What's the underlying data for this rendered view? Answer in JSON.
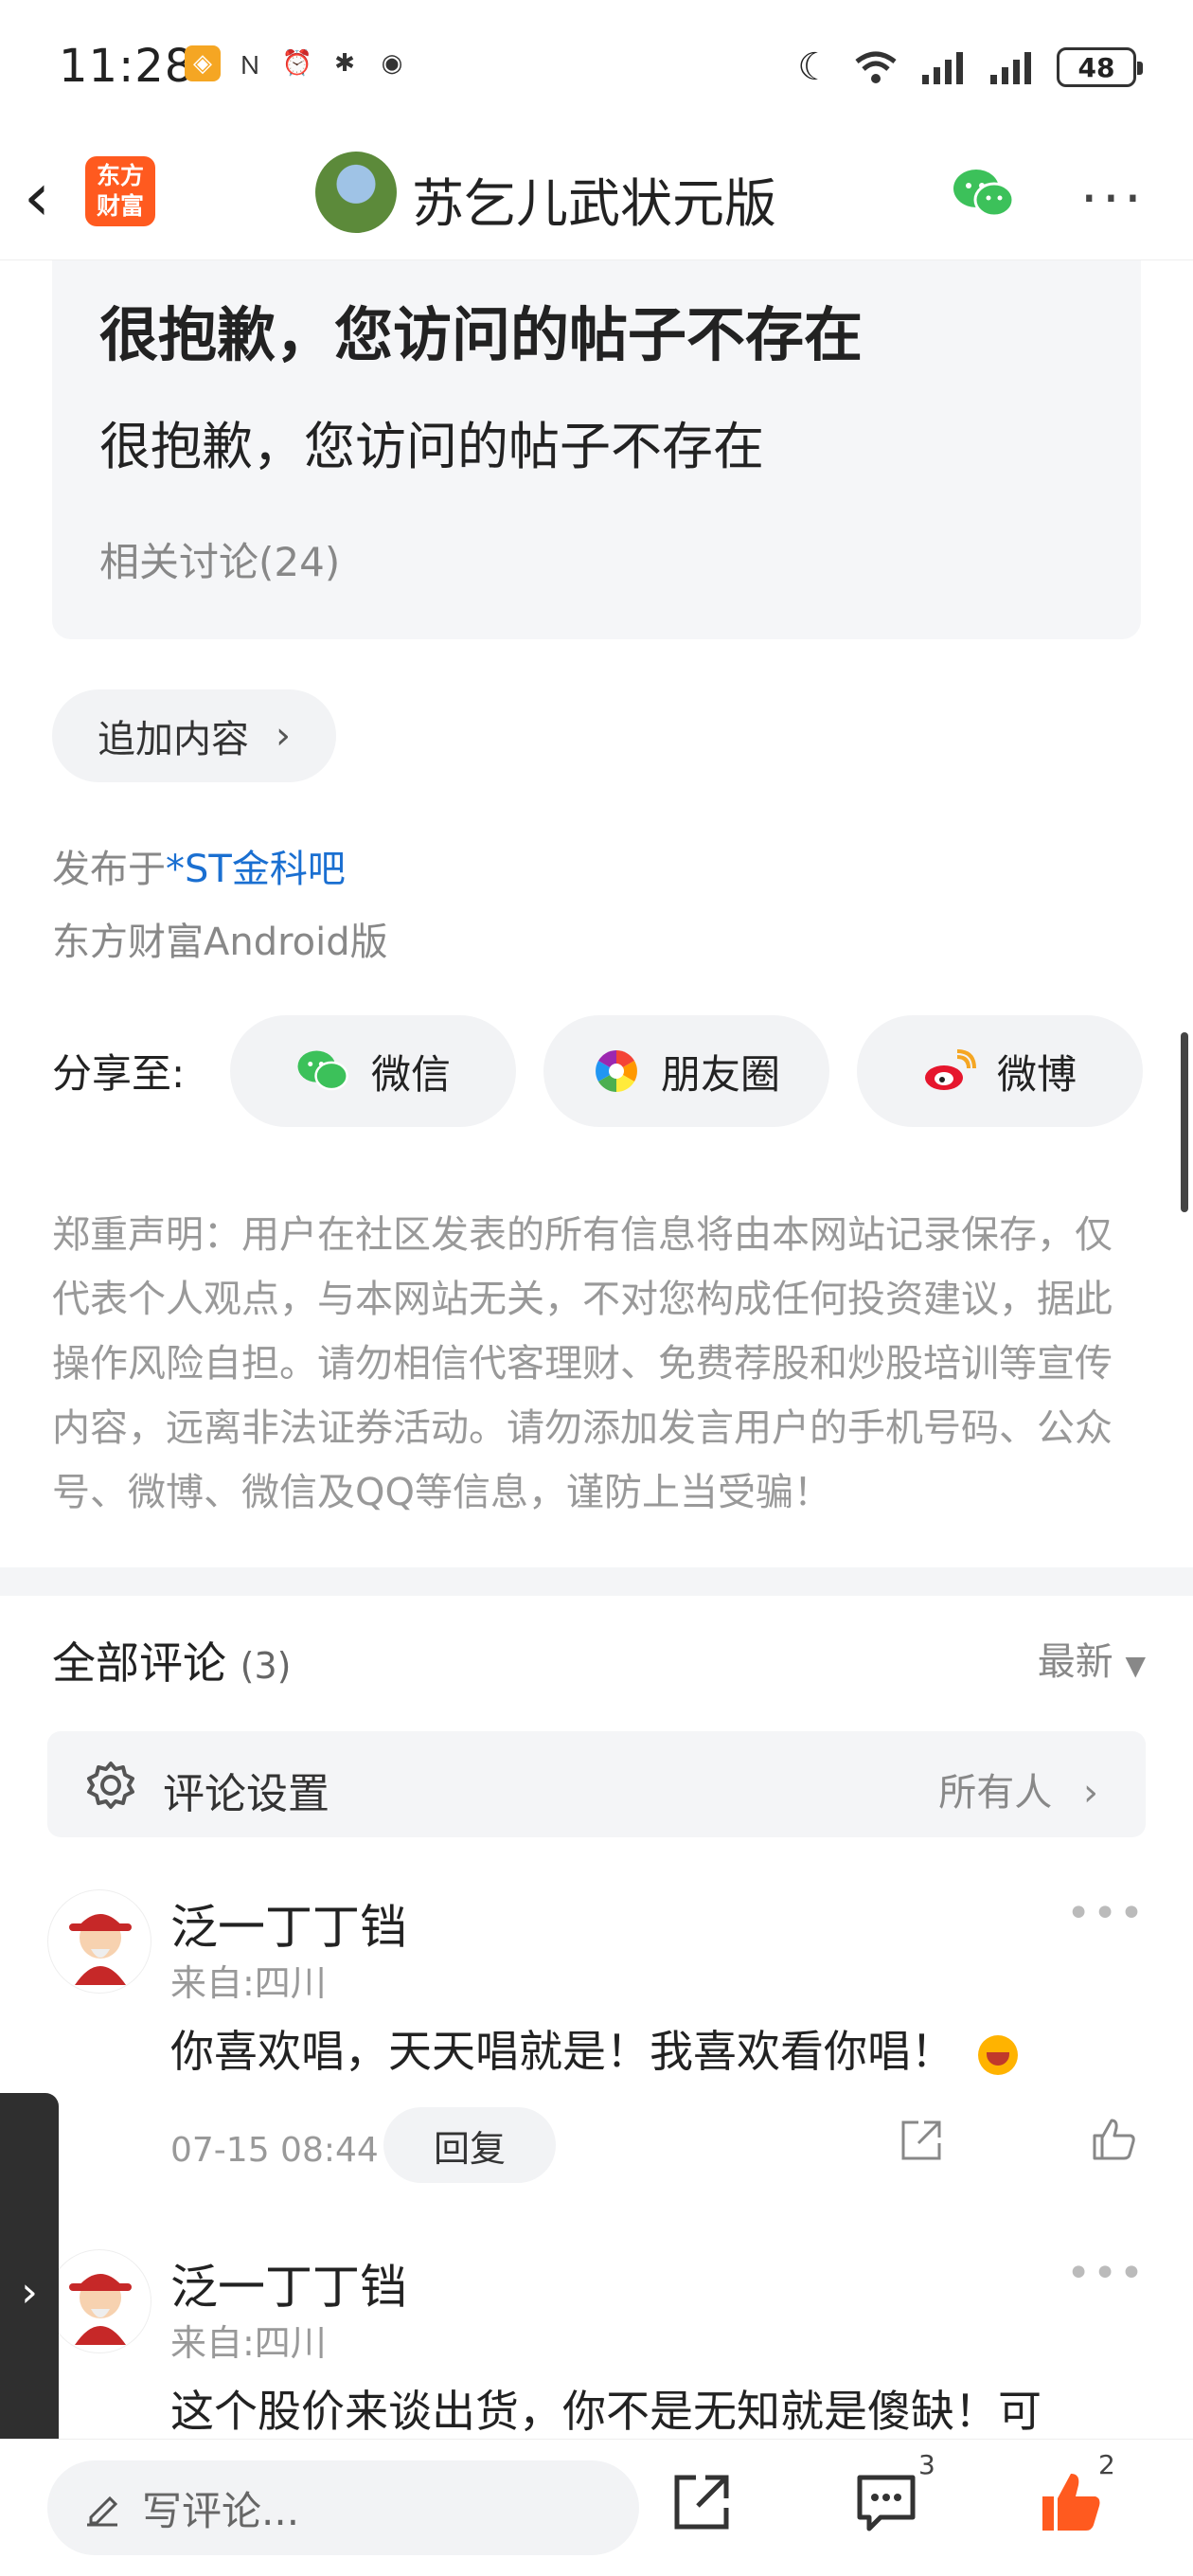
{
  "status_bar": {
    "time": "11:28",
    "battery": "48"
  },
  "header": {
    "app_logo": "东方财富",
    "title": "苏乞儿武状元版"
  },
  "post": {
    "title": "很抱歉，您访问的帖子不存在",
    "subtitle": "很抱歉，您访问的帖子不存在",
    "related": "相关讨论(24)",
    "add_content": "追加内容",
    "published_prefix": "发布于",
    "published_bar": "*ST金科吧",
    "client": "东方财富Android版"
  },
  "share": {
    "label": "分享至:",
    "wechat": "微信",
    "moments": "朋友圈",
    "weibo": "微博"
  },
  "disclaimer": "郑重声明：用户在社区发表的所有信息将由本网站记录保存，仅代表个人观点，与本网站无关，不对您构成任何投资建议，据此操作风险自担。请勿相信代客理财、免费荐股和炒股培训等宣传内容，远离非法证券活动。请勿添加发言用户的手机号码、公众号、微博、微信及QQ等信息，谨防上当受骗！",
  "comments": {
    "title": "全部评论",
    "count": "(3)",
    "sort": "最新",
    "settings_label": "评论设置",
    "settings_value": "所有人",
    "items": [
      {
        "name": "泛一丁丁铛",
        "location": "来自:四川",
        "text": "你喜欢唱，天天唱就是！我喜欢看你唱！",
        "time": "07-15 08:44",
        "reply": "回复"
      },
      {
        "name": "泛一丁丁铛",
        "location": "来自:四川",
        "text": "这个股价来谈出货，你不是无知就是傻缺！可"
      }
    ]
  },
  "bottom_bar": {
    "write_placeholder": "写评论...",
    "comment_count": "3",
    "like_count": "2"
  },
  "colors": {
    "accent": "#ff5a1f",
    "link": "#1a6fd1",
    "like": "#ff5a1f"
  }
}
